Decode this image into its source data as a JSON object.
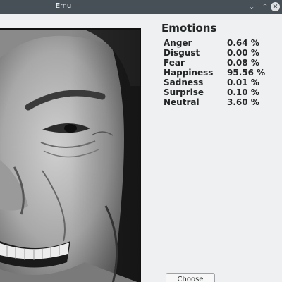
{
  "window": {
    "title": "Emu"
  },
  "titlebar_buttons": {
    "minimize": "⌄",
    "maximize": "⌃",
    "close": "×"
  },
  "panel": {
    "title": "Emotions",
    "rows": [
      {
        "label": "Anger",
        "value": "0.64 %"
      },
      {
        "label": "Disgust",
        "value": "0.00 %"
      },
      {
        "label": "Fear",
        "value": "0.08 %"
      },
      {
        "label": "Happiness",
        "value": "95.56 %"
      },
      {
        "label": "Sadness",
        "value": "0.01 %"
      },
      {
        "label": "Surprise",
        "value": "0.10 %"
      },
      {
        "label": "Neutral",
        "value": "3.60 %"
      }
    ]
  },
  "actions": {
    "choose_image": "Choose Image"
  },
  "colors": {
    "titlebar": "#475057",
    "background": "#eff0f1",
    "text": "#232627"
  }
}
